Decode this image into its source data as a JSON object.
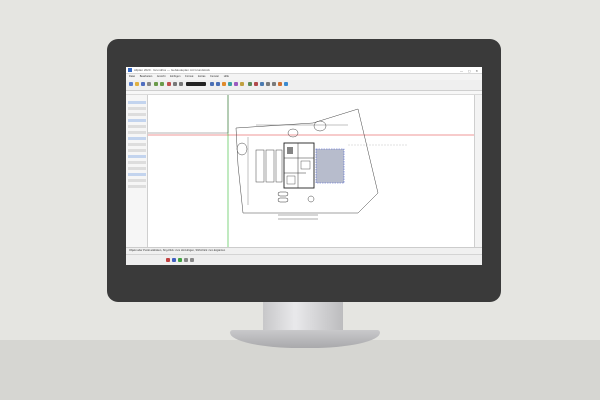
{
  "window": {
    "title": "Allplan 2020 · Grundriss — Gebäudeplan mit Grundstück",
    "controls": "— ▢ ✕"
  },
  "menu": {
    "items": [
      "Datei",
      "Bearbeiten",
      "Ansicht",
      "Einfügen",
      "Format",
      "Extras",
      "Fenster",
      "Hilfe"
    ]
  },
  "status": {
    "text": "Objekt oder Punkt anklicken, Strg-Klick: zum Hinzufügen, Shift-Klick: zum Ergänzen"
  },
  "colors": {
    "screen_bg": "#ffffff",
    "monitor_bezel": "#3a3a3a",
    "wall": "#e5e5e1",
    "red_axis": "#e03030",
    "green_axis": "#2fb82f",
    "selection_blue": "#4a5fd0",
    "drawing_lines": "#303030"
  }
}
